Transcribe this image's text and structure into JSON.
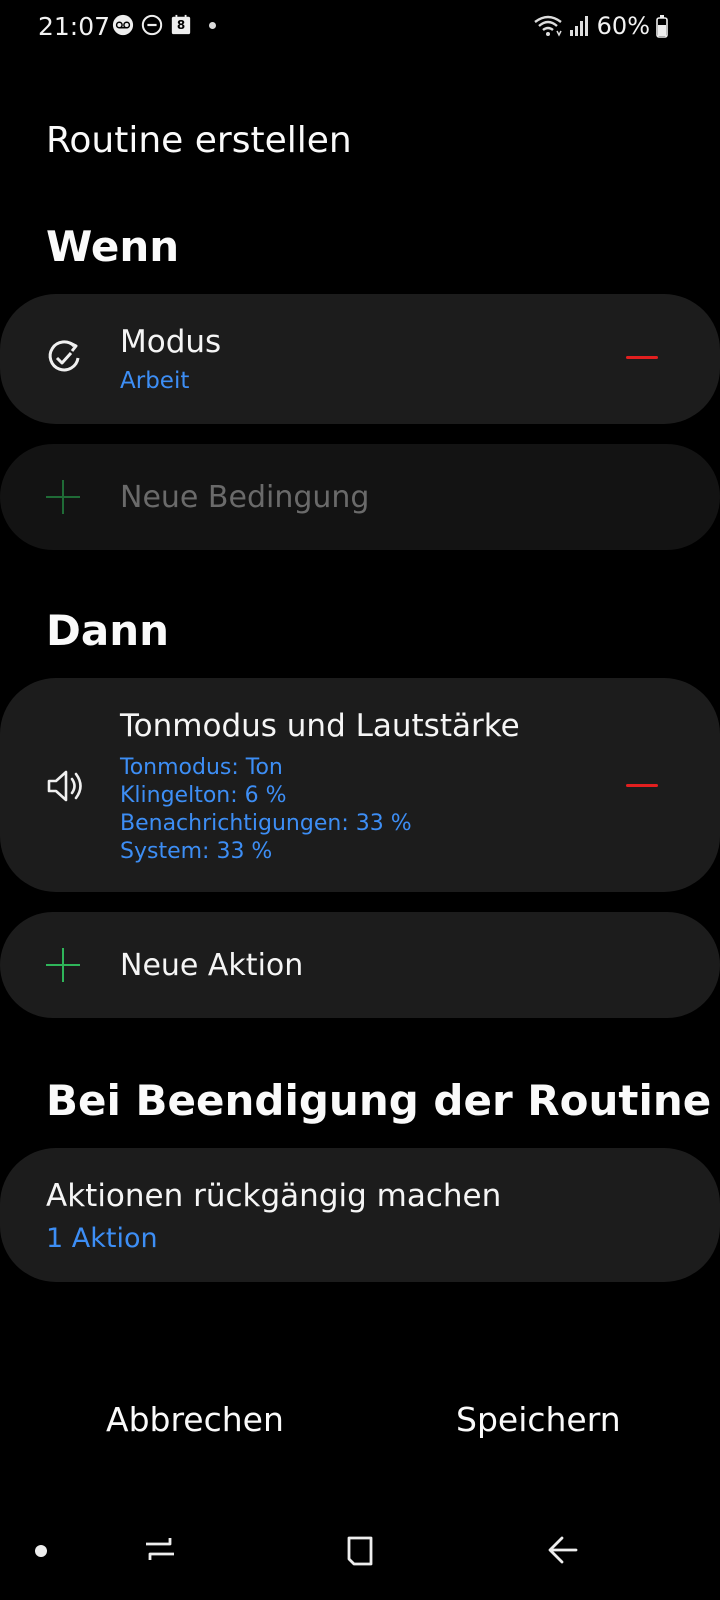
{
  "status_bar": {
    "time": "21:07",
    "icons_left": [
      "voicemail-icon",
      "dnd-icon",
      "calendar-icon",
      "dot-icon"
    ],
    "calendar_day": "8",
    "battery_text": "60%"
  },
  "page": {
    "title": "Routine erstellen"
  },
  "if_section": {
    "title": "Wenn",
    "conditions": [
      {
        "title": "Modus",
        "subtitle": "Arbeit",
        "icon": "mode-check-icon"
      }
    ],
    "add_label": "Neue Bedingung"
  },
  "then_section": {
    "title": "Dann",
    "actions": [
      {
        "title": "Tonmodus und Lautstärke",
        "icon": "speaker-icon",
        "details": [
          "Tonmodus: Ton",
          "Klingelton: 6 %",
          "Benachrichtigungen: 33 %",
          "System: 33 %"
        ]
      }
    ],
    "add_label": "Neue Aktion"
  },
  "end_section": {
    "title": "Bei Beendigung der Routine",
    "item_title": "Aktionen rückgängig machen",
    "item_sub": "1 Aktion"
  },
  "footer": {
    "cancel": "Abbrechen",
    "save": "Speichern"
  },
  "colors": {
    "background": "#000000",
    "card": "#1c1c1c",
    "accent_blue": "#3d8ef5",
    "remove_red": "#e21f1f",
    "add_green": "#2fb55a"
  }
}
